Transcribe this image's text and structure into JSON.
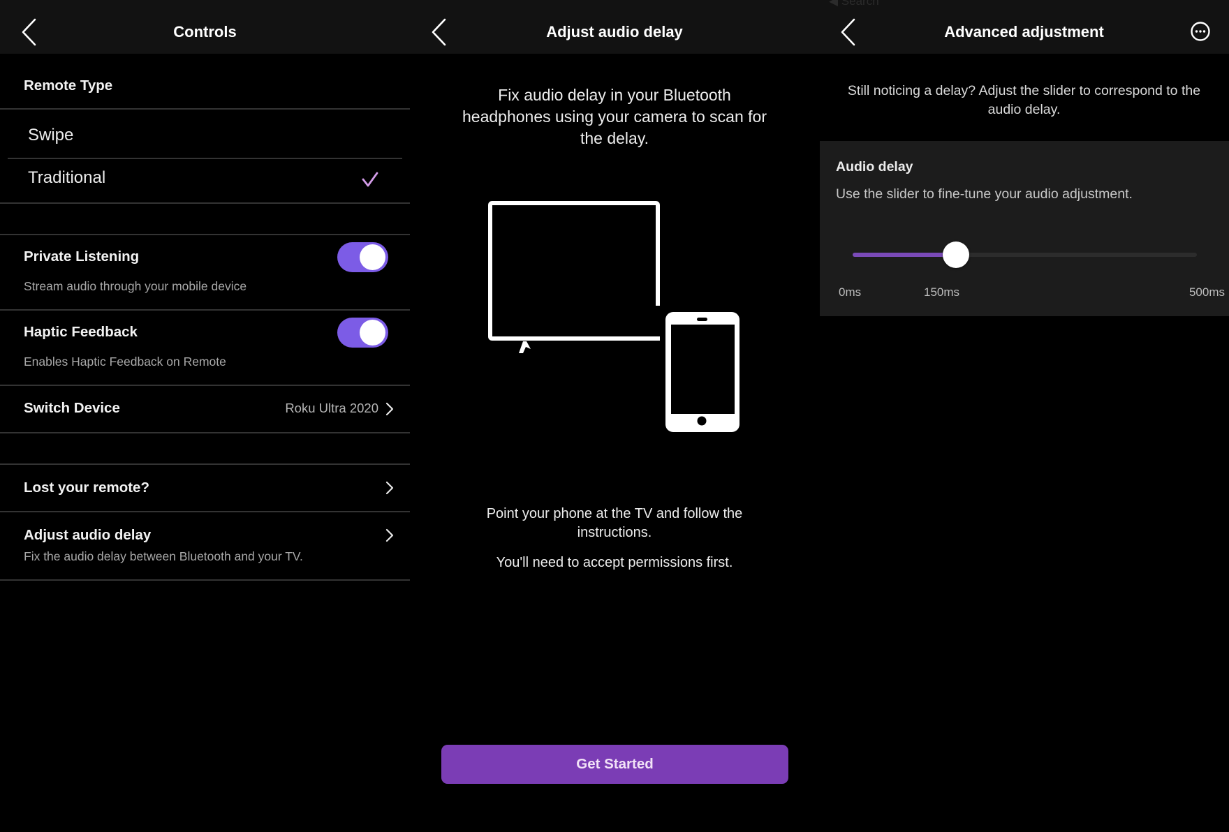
{
  "colors": {
    "accent_purple": "#7b3db5",
    "toggle_purple": "#7c5ce6",
    "checkmark": "#d39ce8",
    "header_bg": "#121212",
    "card_bg": "#1c1c1c",
    "background": "#000000"
  },
  "controls_screen": {
    "header": {
      "title": "Controls",
      "back_icon": "chevron-left-icon"
    },
    "remote_type": {
      "section_title": "Remote Type",
      "options": [
        {
          "label": "Swipe",
          "selected": false
        },
        {
          "label": "Traditional",
          "selected": true
        }
      ],
      "selected_icon": "checkmark-icon"
    },
    "settings": [
      {
        "title": "Private Listening",
        "subtitle": "Stream audio through your mobile device",
        "toggle_on": true
      },
      {
        "title": "Haptic Feedback",
        "subtitle": "Enables Haptic Feedback on Remote",
        "toggle_on": true
      }
    ],
    "switch_device": {
      "title": "Switch Device",
      "value": "Roku Ultra 2020",
      "icon": "chevron-right-icon"
    },
    "links": [
      {
        "title": "Lost your remote?",
        "subtitle": "",
        "icon": "chevron-right-icon"
      },
      {
        "title": "Adjust audio delay",
        "subtitle": "Fix the audio delay between Bluetooth and your TV.",
        "icon": "chevron-right-icon"
      }
    ]
  },
  "audio_delay_screen": {
    "header": {
      "title": "Adjust audio delay",
      "back_icon": "chevron-left-icon"
    },
    "intro": "Fix audio delay in your Bluetooth headphones using your camera to scan for the delay.",
    "illustration": {
      "icons": [
        "tv-icon",
        "phone-icon"
      ]
    },
    "instruction_1": "Point your phone at the TV and follow the instructions.",
    "instruction_2": "You'll need to accept permissions first.",
    "cta_label": "Get Started"
  },
  "advanced_screen": {
    "status_bar_back": "◀ Search",
    "header": {
      "title": "Advanced adjustment",
      "back_icon": "chevron-left-icon",
      "more_icon": "ellipsis-circle-icon"
    },
    "intro": "Still noticing a delay? Adjust the slider to correspond to the audio delay.",
    "card": {
      "title": "Audio delay",
      "subtitle": "Use the slider to fine-tune your audio adjustment.",
      "slider": {
        "min": 0,
        "max": 500,
        "value": 150,
        "unit": "ms"
      },
      "labels": {
        "min": "0ms",
        "current": "150ms",
        "max": "500ms"
      }
    }
  }
}
